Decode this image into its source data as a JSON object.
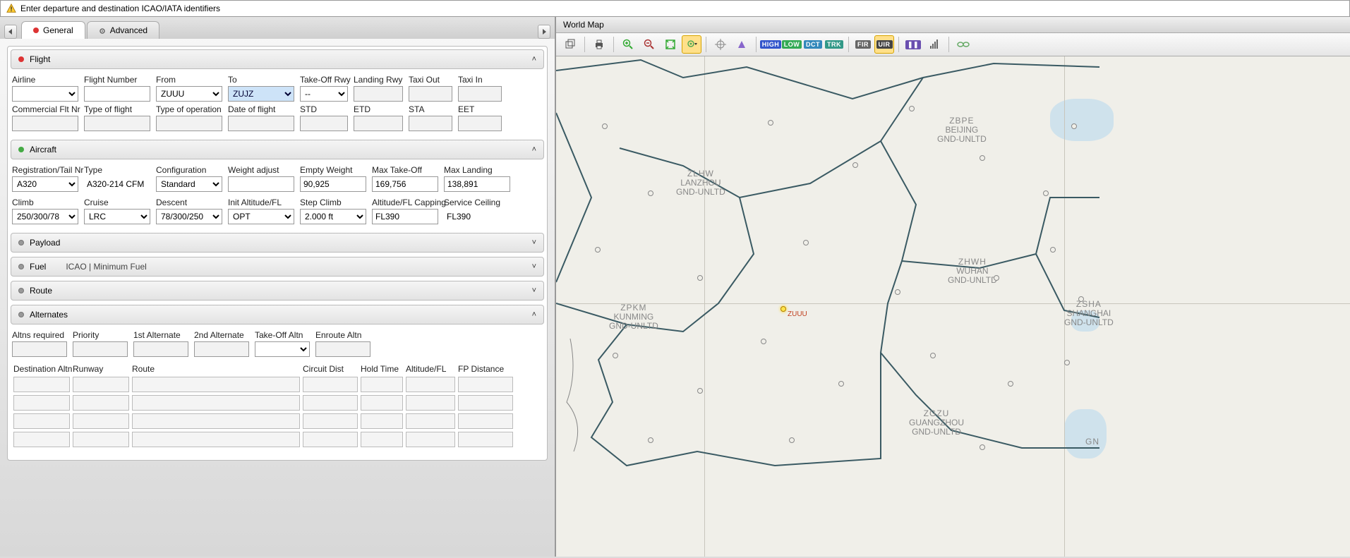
{
  "warning": "Enter departure and destination ICAO/IATA identifiers",
  "tabs": {
    "general": "General",
    "advanced": "Advanced"
  },
  "sections": {
    "flight": {
      "title": "Flight"
    },
    "aircraft": {
      "title": "Aircraft"
    },
    "payload": {
      "title": "Payload"
    },
    "fuel": {
      "title": "Fuel",
      "sub": "ICAO | Minimum Fuel"
    },
    "route": {
      "title": "Route"
    },
    "alternates": {
      "title": "Alternates"
    }
  },
  "flight": {
    "labels": {
      "airline": "Airline",
      "flightnum": "Flight Number",
      "from": "From",
      "to": "To",
      "torwy": "Take-Off Rwy",
      "ldgrwy": "Landing Rwy",
      "taxiout": "Taxi Out",
      "taxiin": "Taxi In",
      "commflt": "Commercial Flt Nr",
      "typeflight": "Type of flight",
      "typeop": "Type of operation",
      "dateflight": "Date of flight",
      "std": "STD",
      "etd": "ETD",
      "sta": "STA",
      "eet": "EET"
    },
    "values": {
      "from": "ZUUU",
      "to": "ZUJZ",
      "torwy": "--"
    }
  },
  "aircraft": {
    "labels": {
      "regtail": "Registration/Tail Nr",
      "type": "Type",
      "config": "Configuration",
      "wadj": "Weight adjust",
      "empty": "Empty Weight",
      "maxto": "Max Take-Off",
      "maxldg": "Max Landing",
      "climb": "Climb",
      "cruise": "Cruise",
      "descent": "Descent",
      "initfl": "Init Altitude/FL",
      "stepclimb": "Step Climb",
      "flcap": "Altitude/FL Capping",
      "svcceil": "Service Ceiling"
    },
    "values": {
      "regtail": "A320",
      "type": "A320-214 CFM",
      "config": "Standard",
      "empty": "90,925",
      "maxto": "169,756",
      "maxldg": "138,891",
      "climb": "250/300/78",
      "cruise": "LRC",
      "descent": "78/300/250",
      "initfl": "OPT",
      "stepclimb": "2.000 ft",
      "flcap": "FL390",
      "svcceil": "FL390"
    }
  },
  "alternates": {
    "labels": {
      "altreq": "Altns required",
      "priority": "Priority",
      "alt1": "1st Alternate",
      "alt2": "2nd Alternate",
      "toaltn": "Take-Off Altn",
      "enraltn": "Enroute Altn",
      "destaltn": "Destination Altn",
      "runway": "Runway",
      "route": "Route",
      "circuit": "Circuit Dist",
      "hold": "Hold Time",
      "altfl": "Altitude/FL",
      "fpdist": "FP Distance"
    }
  },
  "map": {
    "title": "World Map",
    "regions": {
      "zbpe": {
        "code": "ZBPE",
        "name": "BEIJING",
        "alt": "GND-UNLTD"
      },
      "zlhw": {
        "code": "ZLHW",
        "name": "LANZHOU",
        "alt": "GND-UNLTD"
      },
      "zhwh": {
        "code": "ZHWH",
        "name": "WUHAN",
        "alt": "GND-UNLTD"
      },
      "zpkm": {
        "code": "ZPKM",
        "name": "KUNMING",
        "alt": "GND-UNLTD"
      },
      "zsha": {
        "code": "ZSHA",
        "name": "SHANGHAI",
        "alt": "GND-UNLTD"
      },
      "zgzu": {
        "code": "ZGZU",
        "name": "GUANGZHOU",
        "alt": "GND-UNLTD"
      },
      "gn": {
        "code": "GN"
      }
    },
    "dep": "ZUUU"
  },
  "toolbar": {
    "high": "HIGH",
    "low": "LOW",
    "dct": "DCT",
    "trk": "TRK",
    "fir": "FIR",
    "uir": "UIR"
  }
}
